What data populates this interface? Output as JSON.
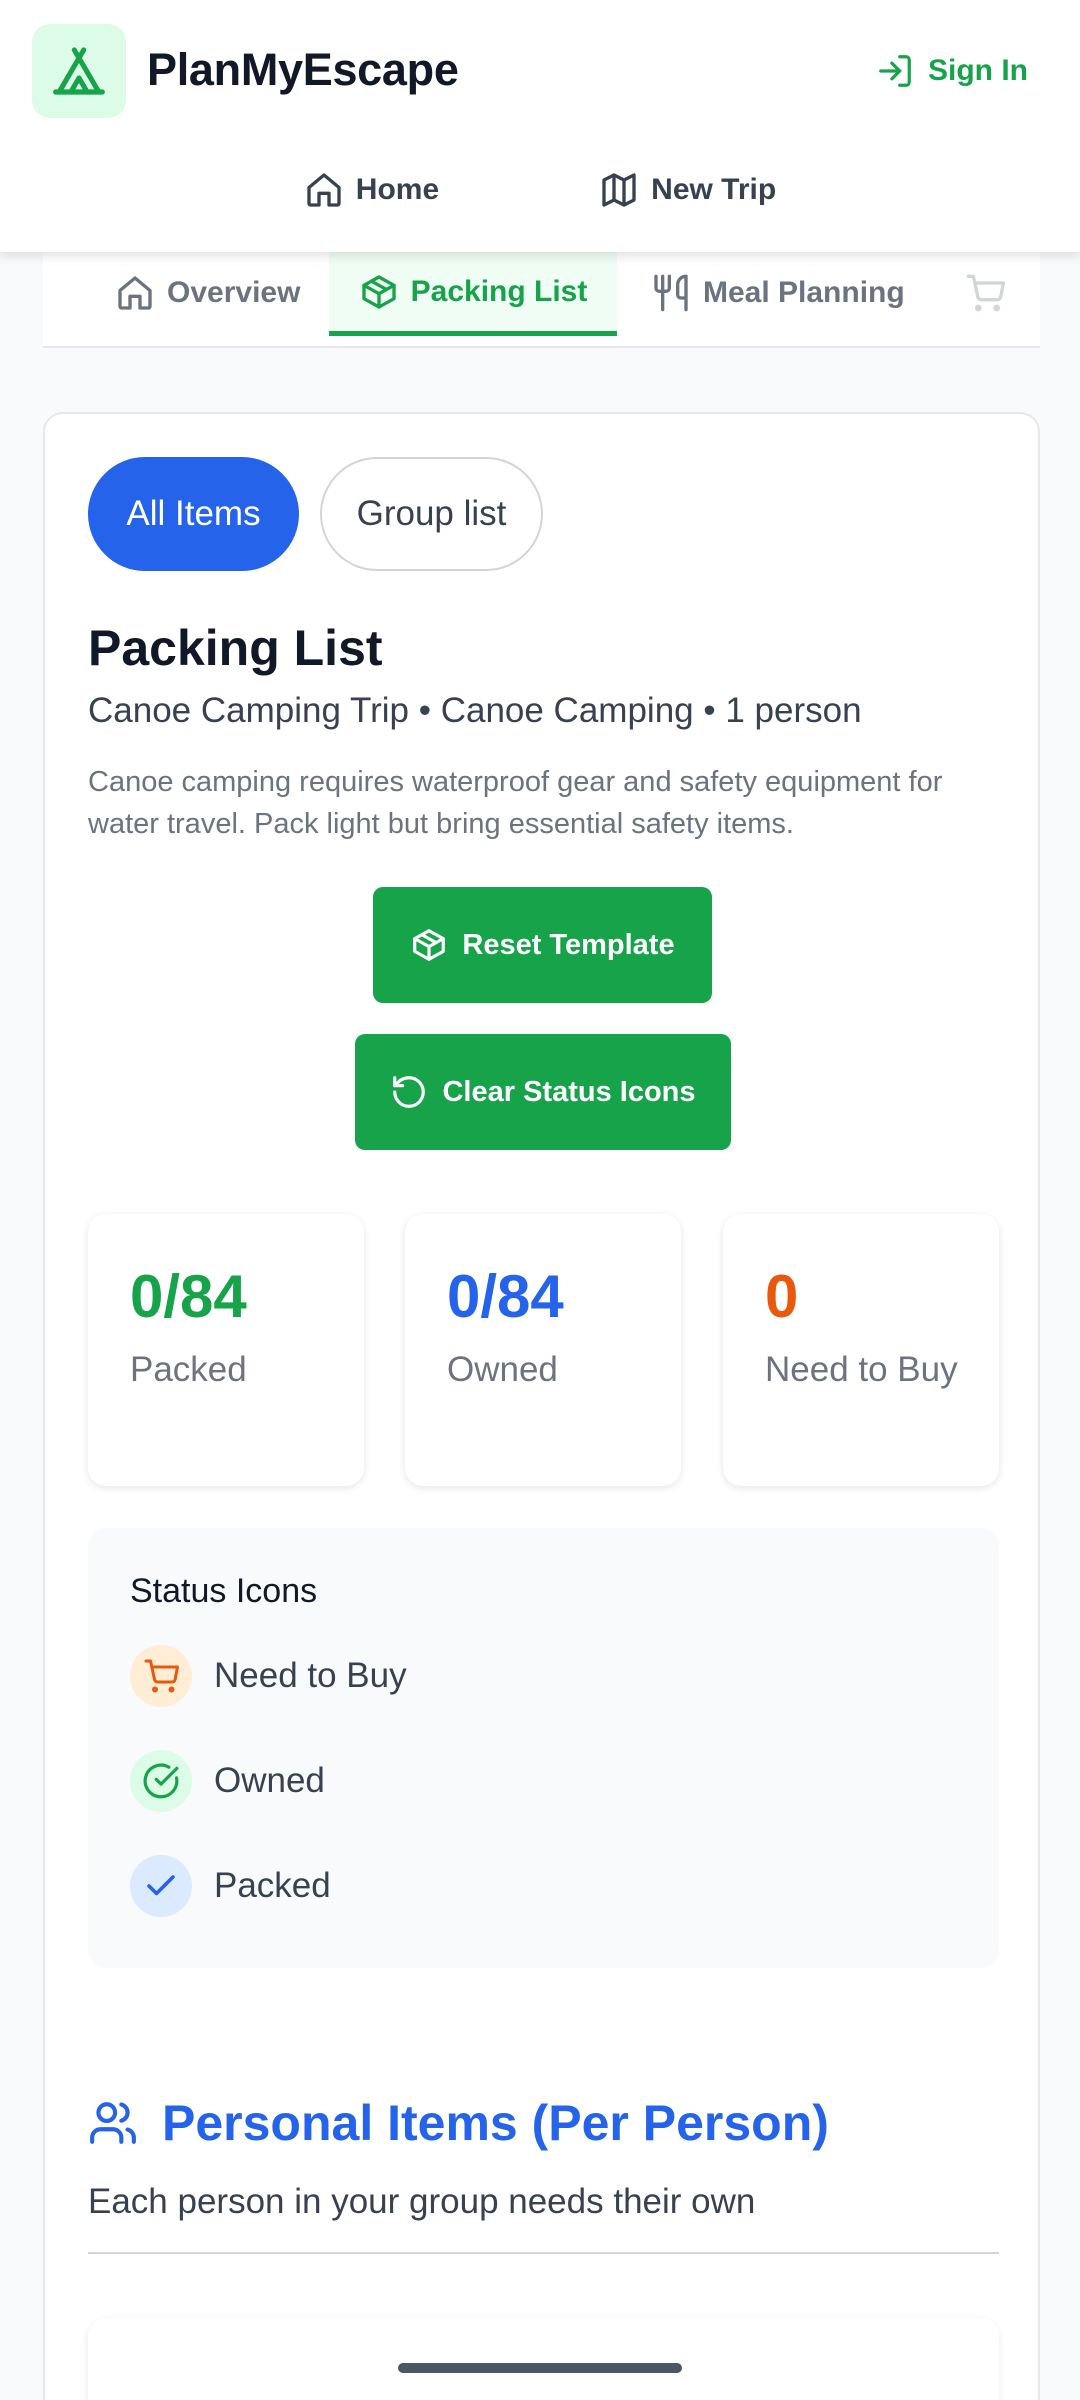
{
  "header": {
    "app_title": "PlanMyEscape",
    "sign_in_label": "Sign In"
  },
  "nav": {
    "home_label": "Home",
    "new_trip_label": "New Trip"
  },
  "subtabs": {
    "overview": "Overview",
    "packing_list": "Packing List",
    "meal_planning": "Meal Planning",
    "active": "Packing List"
  },
  "filters": {
    "all_items": "All Items",
    "group_list": "Group list",
    "active": "All Items"
  },
  "packing": {
    "title": "Packing List",
    "subtitle": "Canoe Camping Trip • Canoe Camping • 1 person",
    "description": "Canoe camping requires waterproof gear and safety equipment for water travel. Pack light but bring essential safety items.",
    "reset_button": "Reset Template",
    "clear_button": "Clear Status Icons"
  },
  "stats": [
    {
      "value": "0/84",
      "label": "Packed",
      "color": "#16a34a"
    },
    {
      "value": "0/84",
      "label": "Owned",
      "color": "#2563eb"
    },
    {
      "value": "0",
      "label": "Need to Buy",
      "color": "#ea580c"
    }
  ],
  "legend": {
    "title": "Status Icons",
    "items": [
      {
        "label": "Need to Buy",
        "icon": "cart-icon",
        "color": "#ea580c",
        "bg": "#ffedd5"
      },
      {
        "label": "Owned",
        "icon": "check-circle-icon",
        "color": "#16a34a",
        "bg": "#dcfce7"
      },
      {
        "label": "Packed",
        "icon": "check-icon",
        "color": "#2563eb",
        "bg": "#dbeafe"
      }
    ]
  },
  "section": {
    "title": "Personal Items (Per Person)",
    "description": "Each person in your group needs their own"
  },
  "colors": {
    "brand_green": "#16a34a",
    "brand_blue": "#2563eb",
    "accent_orange": "#ea580c"
  }
}
